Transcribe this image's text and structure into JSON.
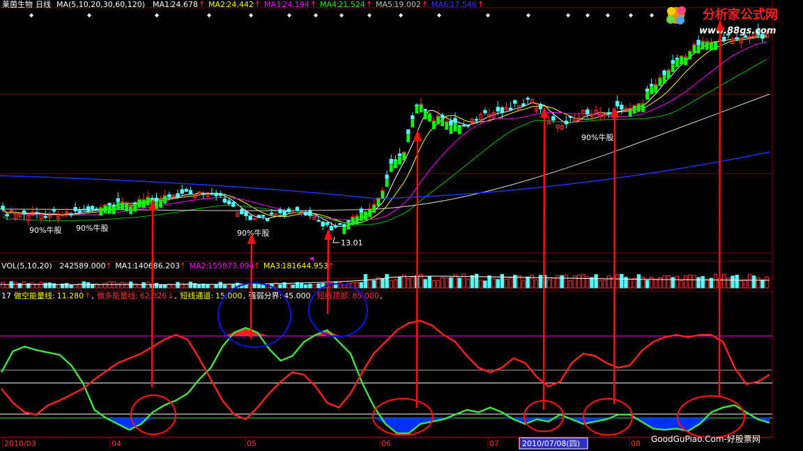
{
  "header": {
    "stock": "莱茵生物",
    "period": "日线",
    "ma_params": "MA(5,10,20,30,60,120)",
    "ma": [
      {
        "label": "MA1:",
        "value": "24.678",
        "arrow": "↑",
        "color": "#ffffff"
      },
      {
        "label": "MA2:",
        "value": "24.442",
        "arrow": "↑",
        "color": "#ffff00"
      },
      {
        "label": "MA3:",
        "value": "24.194",
        "arrow": "↑",
        "color": "#ff00ff"
      },
      {
        "label": "MA4:",
        "value": "21.524",
        "arrow": "↑",
        "color": "#00ff00"
      },
      {
        "label": "MA5:",
        "value": "19.002",
        "arrow": "↑",
        "color": "#c0c0c0"
      },
      {
        "label": "MA6:",
        "value": "17.546",
        "arrow": "↑",
        "color": "#3030ff"
      }
    ]
  },
  "logo": {
    "brand": "分析家公式网",
    "url": "www.88gs.com"
  },
  "vol_header": {
    "params": "VOL(5,10,20)",
    "value": "242589.000",
    "arrow": "↑",
    "ma": [
      {
        "label": "MA1:",
        "value": "140686.203",
        "arrow": "↑",
        "color": "#ffffff"
      },
      {
        "label": "MA2:",
        "value": "155873.094",
        "arrow": "↑",
        "color": "#ff00ff"
      },
      {
        "label": "MA3:",
        "value": "181644.953",
        "arrow": "↑",
        "color": "#ffff00"
      }
    ]
  },
  "ind_header": {
    "prefix": "17",
    "items": [
      {
        "label": "做空能量线:",
        "value": "11.280",
        "arrow": "↑",
        "color": "#ffff00"
      },
      {
        "label": "做多能量线:",
        "value": "62.026",
        "arrow": "↓",
        "color": "#ff3030"
      },
      {
        "label": "短线通道:",
        "value": "15.000",
        "arrow": "",
        "color": "#ffff00"
      },
      {
        "label": "强弱分界:",
        "value": "45.000",
        "arrow": "",
        "color": "#ffffff"
      },
      {
        "label": "短线顶部:",
        "value": "85.000",
        "arrow": "",
        "color": "#ff3030"
      }
    ]
  },
  "annotations": {
    "bull_labels": [
      "90%牛股",
      "90%牛股",
      "90%牛股",
      "90%牛股"
    ],
    "low_price": "13.01"
  },
  "x_axis": {
    "labels": [
      "2010/03",
      "04",
      "05",
      "06",
      "07",
      "2010/07/08(四)",
      "08"
    ]
  },
  "footer": {
    "site": "GoodGuPiao.Com-好股票网"
  },
  "colors": {
    "up": "#ff3030",
    "down": "#54ffff",
    "bull_bar": "#00ff00",
    "grid": "#800000",
    "energy_short": "#40e040",
    "energy_long": "#ff2020",
    "blue_fill": "#0030ff",
    "annotation_red": "#ff1010",
    "annotation_blue": "#1010e0"
  },
  "chart_data": {
    "type": "line",
    "title": "",
    "series": [
      {
        "name": "做空能量线",
        "values": [
          54,
          72,
          76,
          73,
          71,
          69,
          60,
          45,
          22,
          15,
          10,
          5,
          10,
          20,
          26,
          30,
          36,
          48,
          58,
          76,
          88,
          92,
          88,
          74,
          64,
          68,
          80,
          86,
          90,
          80,
          70,
          45,
          25,
          10,
          2,
          2,
          10,
          12,
          14,
          18,
          22,
          20,
          24,
          20,
          14,
          10,
          14,
          12,
          18,
          14,
          10,
          12,
          14,
          18,
          18,
          12,
          6,
          5,
          6,
          4,
          10,
          20,
          24,
          26,
          20,
          14,
          11
        ]
      },
      {
        "name": "做多能量线",
        "values": [
          40,
          28,
          20,
          18,
          26,
          30,
          35,
          40,
          48,
          55,
          62,
          66,
          70,
          76,
          82,
          86,
          82,
          66,
          48,
          30,
          18,
          14,
          24,
          36,
          46,
          54,
          52,
          42,
          28,
          24,
          36,
          54,
          70,
          80,
          90,
          96,
          98,
          94,
          86,
          80,
          68,
          58,
          54,
          58,
          66,
          62,
          50,
          42,
          46,
          62,
          70,
          68,
          62,
          58,
          60,
          72,
          80,
          84,
          86,
          84,
          86,
          86,
          80,
          58,
          44,
          46,
          52
        ]
      }
    ],
    "reference_lines": [
      {
        "value": 15,
        "label": "短线通道"
      },
      {
        "value": 45,
        "label": "强弱分界"
      },
      {
        "value": 85,
        "label": "短线顶部"
      }
    ],
    "ylim": [
      0,
      110
    ]
  }
}
